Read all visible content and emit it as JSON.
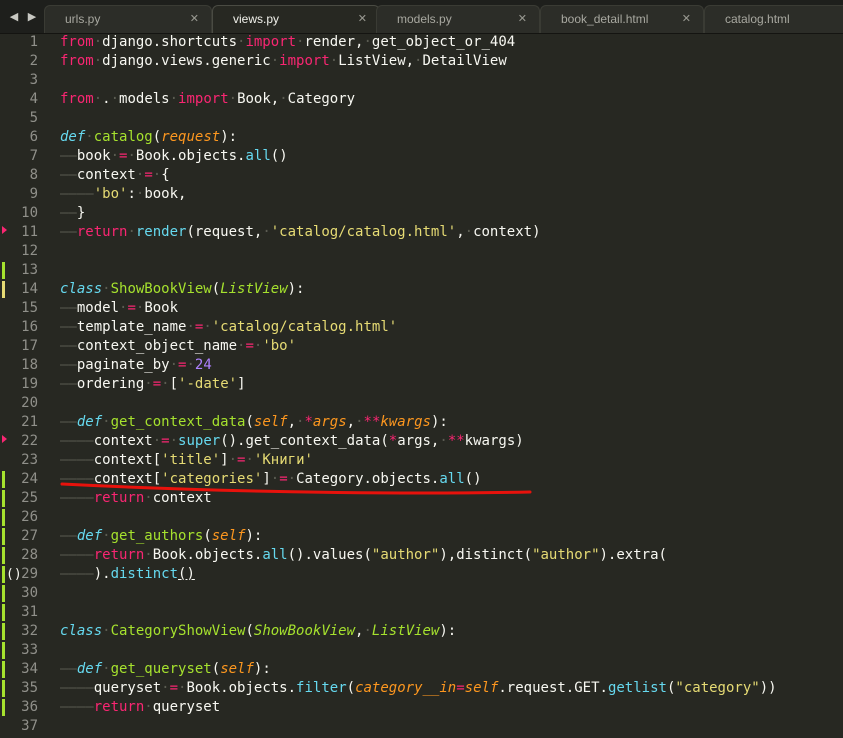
{
  "tabbar": {
    "nav_left": "◀",
    "nav_right": "▶",
    "close_glyph": "✕",
    "tabs": [
      {
        "label": "urls.py",
        "active": false
      },
      {
        "label": "views.py",
        "active": true
      },
      {
        "label": "models.py",
        "active": false
      },
      {
        "label": "book_detail.html",
        "active": false
      },
      {
        "label": "catalog.html",
        "active": false
      }
    ]
  },
  "editor": {
    "gutter_paren": "()",
    "lines": [
      {
        "num": "1",
        "code": [
          [
            "k",
            "from"
          ],
          [
            "ws",
            "·"
          ],
          [
            "",
            "django.shortcuts"
          ],
          [
            "ws",
            "·"
          ],
          [
            "k",
            "import"
          ],
          [
            "ws",
            "·"
          ],
          [
            "",
            "render,"
          ],
          [
            "ws",
            "·"
          ],
          [
            "",
            "get_object_or_404"
          ]
        ]
      },
      {
        "num": "2",
        "code": [
          [
            "k",
            "from"
          ],
          [
            "ws",
            "·"
          ],
          [
            "",
            "django.views.generic"
          ],
          [
            "ws",
            "·"
          ],
          [
            "k",
            "import"
          ],
          [
            "ws",
            "·"
          ],
          [
            "",
            "ListView,"
          ],
          [
            "ws",
            "·"
          ],
          [
            "",
            "DetailView"
          ]
        ]
      },
      {
        "num": "3",
        "code": []
      },
      {
        "num": "4",
        "code": [
          [
            "k",
            "from"
          ],
          [
            "ws",
            "·"
          ],
          [
            "",
            "."
          ],
          [
            "ws",
            "·"
          ],
          [
            "",
            "models"
          ],
          [
            "ws",
            "·"
          ],
          [
            "k",
            "import"
          ],
          [
            "ws",
            "·"
          ],
          [
            "",
            "Book,"
          ],
          [
            "ws",
            "·"
          ],
          [
            "",
            "Category"
          ]
        ]
      },
      {
        "num": "5",
        "code": []
      },
      {
        "num": "6",
        "code": [
          [
            "d",
            "def"
          ],
          [
            "ws",
            "·"
          ],
          [
            "f",
            "catalog"
          ],
          [
            "",
            "("
          ],
          [
            "p",
            "request"
          ],
          [
            "",
            "):"
          ]
        ]
      },
      {
        "num": "7",
        "code": [
          [
            "ws",
            "——"
          ],
          [
            "",
            "book"
          ],
          [
            "ws",
            "·"
          ],
          [
            "k",
            "="
          ],
          [
            "ws",
            "·"
          ],
          [
            "",
            "Book.objects."
          ],
          [
            "c",
            "all"
          ],
          [
            "",
            "()"
          ]
        ]
      },
      {
        "num": "8",
        "code": [
          [
            "ws",
            "——"
          ],
          [
            "",
            "context"
          ],
          [
            "ws",
            "·"
          ],
          [
            "k",
            "="
          ],
          [
            "ws",
            "·"
          ],
          [
            "",
            "{"
          ]
        ]
      },
      {
        "num": "9",
        "code": [
          [
            "ws",
            "————"
          ],
          [
            "s",
            "'bo'"
          ],
          [
            "",
            ":"
          ],
          [
            "ws",
            "·"
          ],
          [
            "",
            "book,"
          ]
        ]
      },
      {
        "num": "10",
        "code": [
          [
            "ws",
            "——"
          ],
          [
            "",
            "}"
          ]
        ]
      },
      {
        "num": "11",
        "code": [
          [
            "ws",
            "——"
          ],
          [
            "k",
            "return"
          ],
          [
            "ws",
            "·"
          ],
          [
            "c",
            "render"
          ],
          [
            "",
            "(request,"
          ],
          [
            "ws",
            "·"
          ],
          [
            "s",
            "'catalog/catalog.html'"
          ],
          [
            "",
            ","
          ],
          [
            "ws",
            "·"
          ],
          [
            "",
            "context)"
          ]
        ]
      },
      {
        "num": "12",
        "code": []
      },
      {
        "num": "13",
        "code": []
      },
      {
        "num": "14",
        "code": [
          [
            "d",
            "class"
          ],
          [
            "ws",
            "·"
          ],
          [
            "f",
            "ShowBookView"
          ],
          [
            "",
            "("
          ],
          [
            "ib",
            "ListView"
          ],
          [
            "",
            "):"
          ]
        ]
      },
      {
        "num": "15",
        "code": [
          [
            "ws",
            "——"
          ],
          [
            "",
            "model"
          ],
          [
            "ws",
            "·"
          ],
          [
            "k",
            "="
          ],
          [
            "ws",
            "·"
          ],
          [
            "",
            "Book"
          ]
        ]
      },
      {
        "num": "16",
        "code": [
          [
            "ws",
            "——"
          ],
          [
            "",
            "template_name"
          ],
          [
            "ws",
            "·"
          ],
          [
            "k",
            "="
          ],
          [
            "ws",
            "·"
          ],
          [
            "s",
            "'catalog/catalog.html'"
          ]
        ]
      },
      {
        "num": "17",
        "code": [
          [
            "ws",
            "——"
          ],
          [
            "",
            "context_object_name"
          ],
          [
            "ws",
            "·"
          ],
          [
            "k",
            "="
          ],
          [
            "ws",
            "·"
          ],
          [
            "s",
            "'bo'"
          ]
        ]
      },
      {
        "num": "18",
        "code": [
          [
            "ws",
            "——"
          ],
          [
            "",
            "paginate_by"
          ],
          [
            "ws",
            "·"
          ],
          [
            "k",
            "="
          ],
          [
            "ws",
            "·"
          ],
          [
            "n",
            "24"
          ]
        ]
      },
      {
        "num": "19",
        "code": [
          [
            "ws",
            "——"
          ],
          [
            "",
            "ordering"
          ],
          [
            "ws",
            "·"
          ],
          [
            "k",
            "="
          ],
          [
            "ws",
            "·"
          ],
          [
            "",
            "["
          ],
          [
            "s",
            "'-date'"
          ],
          [
            "",
            "]"
          ]
        ]
      },
      {
        "num": "20",
        "code": []
      },
      {
        "num": "21",
        "code": [
          [
            "ws",
            "——"
          ],
          [
            "d",
            "def"
          ],
          [
            "ws",
            "·"
          ],
          [
            "f",
            "get_context_data"
          ],
          [
            "",
            "("
          ],
          [
            "p",
            "self"
          ],
          [
            "",
            ","
          ],
          [
            "ws",
            "·"
          ],
          [
            "k",
            "*"
          ],
          [
            "p",
            "args"
          ],
          [
            "",
            ","
          ],
          [
            "ws",
            "·"
          ],
          [
            "k",
            "**"
          ],
          [
            "p",
            "kwargs"
          ],
          [
            "",
            "):"
          ]
        ]
      },
      {
        "num": "22",
        "code": [
          [
            "ws",
            "————"
          ],
          [
            "",
            "context"
          ],
          [
            "ws",
            "·"
          ],
          [
            "k",
            "="
          ],
          [
            "ws",
            "·"
          ],
          [
            "c",
            "super"
          ],
          [
            "",
            "().get_context_data("
          ],
          [
            "k",
            "*"
          ],
          [
            "",
            "args,"
          ],
          [
            "ws",
            "·"
          ],
          [
            "k",
            "**"
          ],
          [
            "",
            "kwargs)"
          ]
        ]
      },
      {
        "num": "23",
        "code": [
          [
            "ws",
            "————"
          ],
          [
            "",
            "context["
          ],
          [
            "s",
            "'title'"
          ],
          [
            "",
            "]"
          ],
          [
            "ws",
            "·"
          ],
          [
            "k",
            "="
          ],
          [
            "ws",
            "·"
          ],
          [
            "s",
            "'Книги'"
          ]
        ]
      },
      {
        "num": "24",
        "code": [
          [
            "ws",
            "————"
          ],
          [
            "",
            "context["
          ],
          [
            "s",
            "'categories'"
          ],
          [
            "",
            "]"
          ],
          [
            "ws",
            "·"
          ],
          [
            "k",
            "="
          ],
          [
            "ws",
            "·"
          ],
          [
            "",
            "Category.objects."
          ],
          [
            "c",
            "all"
          ],
          [
            "",
            "()"
          ]
        ]
      },
      {
        "num": "25",
        "code": [
          [
            "ws",
            "————"
          ],
          [
            "k",
            "return"
          ],
          [
            "ws",
            "·"
          ],
          [
            "",
            "context"
          ]
        ]
      },
      {
        "num": "26",
        "code": []
      },
      {
        "num": "27",
        "code": [
          [
            "ws",
            "——"
          ],
          [
            "d",
            "def"
          ],
          [
            "ws",
            "·"
          ],
          [
            "f",
            "get_authors"
          ],
          [
            "",
            "("
          ],
          [
            "p",
            "self"
          ],
          [
            "",
            "):"
          ]
        ]
      },
      {
        "num": "28",
        "code": [
          [
            "ws",
            "————"
          ],
          [
            "k",
            "return"
          ],
          [
            "ws",
            "·"
          ],
          [
            "",
            "Book.objects."
          ],
          [
            "c",
            "all"
          ],
          [
            "",
            "().values("
          ],
          [
            "s",
            "\"author\""
          ],
          [
            "",
            "),distinct("
          ],
          [
            "s",
            "\"author\""
          ],
          [
            "",
            ").extra("
          ]
        ]
      },
      {
        "num": "29",
        "code": [
          [
            "ws",
            "————"
          ],
          [
            "",
            ")."
          ],
          [
            "c",
            "distinct"
          ],
          [
            "bm",
            "()"
          ]
        ]
      },
      {
        "num": "30",
        "code": []
      },
      {
        "num": "31",
        "code": []
      },
      {
        "num": "32",
        "code": [
          [
            "d",
            "class"
          ],
          [
            "ws",
            "·"
          ],
          [
            "f",
            "CategoryShowView"
          ],
          [
            "",
            "("
          ],
          [
            "ib",
            "ShowBookView"
          ],
          [
            "",
            ","
          ],
          [
            "ws",
            "·"
          ],
          [
            "ib",
            "ListView"
          ],
          [
            "",
            "):"
          ]
        ]
      },
      {
        "num": "33",
        "code": []
      },
      {
        "num": "34",
        "code": [
          [
            "ws",
            "——"
          ],
          [
            "d",
            "def"
          ],
          [
            "ws",
            "·"
          ],
          [
            "f",
            "get_queryset"
          ],
          [
            "",
            "("
          ],
          [
            "p",
            "self"
          ],
          [
            "",
            "):"
          ]
        ]
      },
      {
        "num": "35",
        "code": [
          [
            "ws",
            "————"
          ],
          [
            "",
            "queryset"
          ],
          [
            "ws",
            "·"
          ],
          [
            "k",
            "="
          ],
          [
            "ws",
            "·"
          ],
          [
            "",
            "Book.objects."
          ],
          [
            "c",
            "filter"
          ],
          [
            "",
            "("
          ],
          [
            "p",
            "category__in"
          ],
          [
            "k",
            "="
          ],
          [
            "p",
            "self"
          ],
          [
            "",
            ".request.GET."
          ],
          [
            "c",
            "getlist"
          ],
          [
            "",
            "("
          ],
          [
            "s",
            "\"category\""
          ],
          [
            "",
            "))"
          ]
        ]
      },
      {
        "num": "36",
        "code": [
          [
            "ws",
            "————"
          ],
          [
            "k",
            "return"
          ],
          [
            "ws",
            "·"
          ],
          [
            "",
            "queryset"
          ]
        ]
      },
      {
        "num": "37",
        "code": []
      }
    ]
  },
  "colors": {
    "background": "#272822",
    "keyword": "#f92672",
    "string": "#e6db74",
    "function": "#a6e22e",
    "builtin": "#66d9ef",
    "param": "#fd971f",
    "number": "#ae81ff",
    "annotation": "#e8120c"
  }
}
